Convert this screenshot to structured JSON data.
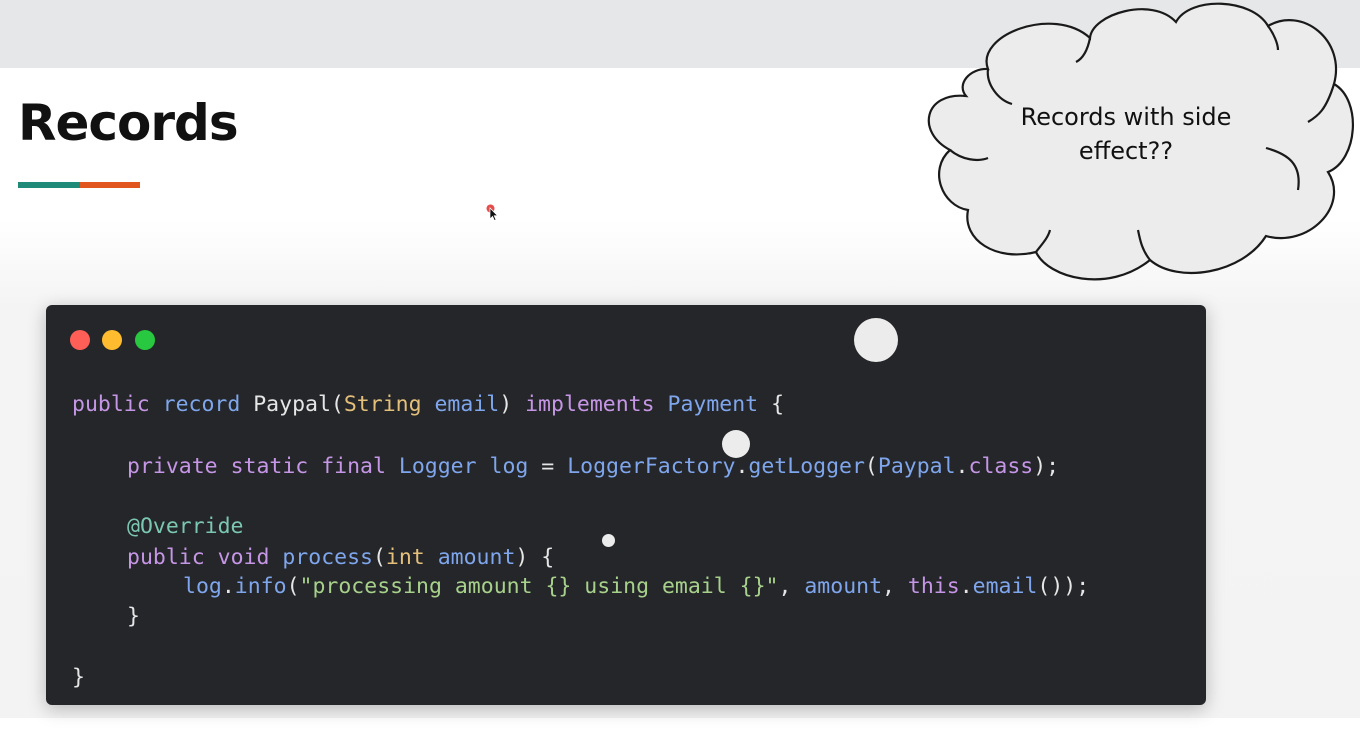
{
  "slide": {
    "title": "Records",
    "underline_colors": [
      "#1f8a78",
      "#e0561e"
    ]
  },
  "callout": {
    "line1": "Records with side",
    "line2": "effect??"
  },
  "code_window": {
    "controls": [
      "close",
      "minimize",
      "zoom"
    ],
    "lines": {
      "l1": {
        "t1": "public",
        "t2": " ",
        "t3": "record",
        "t4": " Paypal(",
        "t5": "String",
        "t6": " ",
        "t7": "email",
        "t8": ") ",
        "t9": "implements",
        "t10": " ",
        "t11": "Payment",
        "t12": " {"
      },
      "l2": {
        "t1": "private",
        "t2": " ",
        "t3": "static",
        "t4": " ",
        "t5": "final",
        "t6": " ",
        "t7": "Logger",
        "t8": " ",
        "t9": "log",
        "t10": " = ",
        "t11": "LoggerFactory",
        "t12": ".",
        "t13": "getLogger",
        "t14": "(",
        "t15": "Paypal",
        "t16": ".",
        "t17": "class",
        "t18": ");"
      },
      "l3": {
        "t1": "@Override"
      },
      "l4": {
        "t1": "public",
        "t2": " ",
        "t3": "void",
        "t4": " ",
        "t5": "process",
        "t6": "(",
        "t7": "int",
        "t8": " ",
        "t9": "amount",
        "t10": ") {"
      },
      "l5": {
        "t1": "log",
        "t2": ".",
        "t3": "info",
        "t4": "(",
        "t5": "\"processing amount {} using email {}\"",
        "t6": ", ",
        "t7": "amount",
        "t8": ", ",
        "t9": "this",
        "t10": ".",
        "t11": "email",
        "t12": "());"
      },
      "l6": {
        "t1": "}"
      },
      "l7": {
        "t1": "}"
      }
    }
  }
}
